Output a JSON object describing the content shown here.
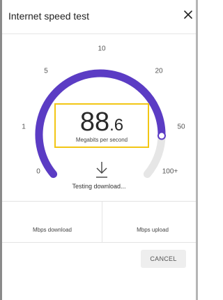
{
  "dialog": {
    "title": "Internet speed test",
    "close_label": "×"
  },
  "gauge": {
    "tick_labels": [
      "0",
      "1",
      "5",
      "10",
      "20",
      "50",
      "100+"
    ],
    "accent_color": "#5b3cc4",
    "track_color": "#e6e6e6"
  },
  "speed": {
    "integer_part": "88",
    "decimal_part": ".6",
    "unit": "Megabits per second"
  },
  "status": {
    "icon": "download-arrow-icon",
    "text": "Testing download..."
  },
  "results": {
    "download_label": "Mbps download",
    "upload_label": "Mbps upload"
  },
  "actions": {
    "cancel_label": "CANCEL"
  }
}
